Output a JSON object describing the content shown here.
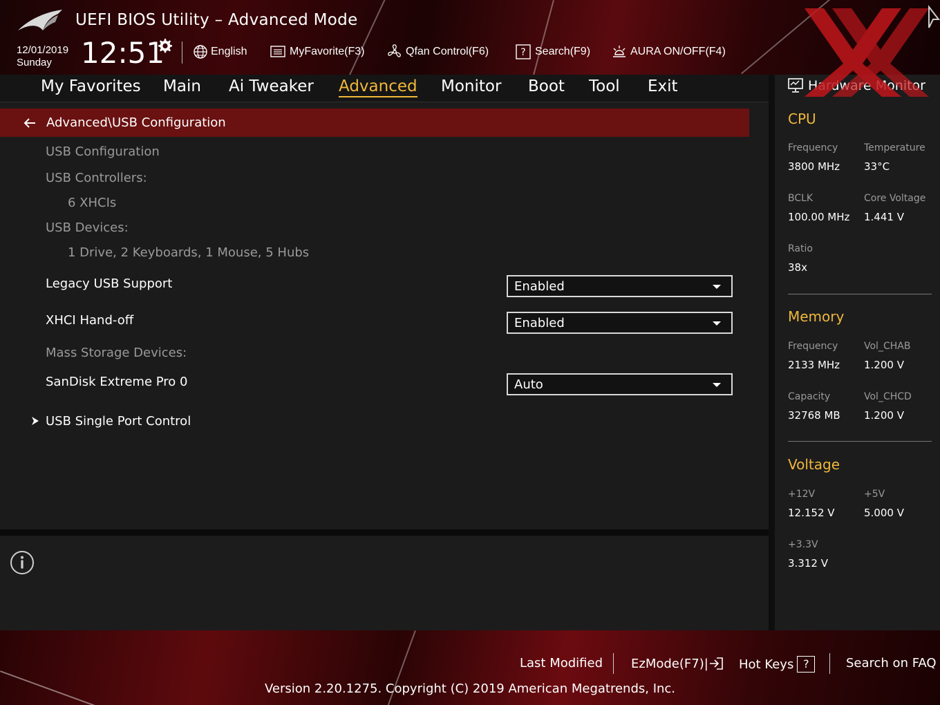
{
  "header": {
    "title": "UEFI BIOS Utility – Advanced Mode",
    "date": "12/01/2019",
    "day": "Sunday",
    "time": "12:51",
    "tools": [
      {
        "label": "English",
        "icon": "globe-icon"
      },
      {
        "label": "MyFavorite(F3)",
        "icon": "favorite-list-icon"
      },
      {
        "label": "Qfan Control(F6)",
        "icon": "fan-icon"
      },
      {
        "label": "Search(F9)",
        "icon": "search-help-icon"
      },
      {
        "label": "AURA ON/OFF(F4)",
        "icon": "aura-light-icon"
      }
    ]
  },
  "nav": {
    "tabs": [
      "My Favorites",
      "Main",
      "Ai Tweaker",
      "Advanced",
      "Monitor",
      "Boot",
      "Tool",
      "Exit"
    ],
    "active": "Advanced"
  },
  "main": {
    "breadcrumb": "Advanced\\USB Configuration",
    "items": {
      "usb_config": "USB Configuration",
      "controllers_label": "USB Controllers:",
      "controllers_value": "6 XHCIs",
      "devices_label": "USB Devices:",
      "devices_value": "1 Drive, 2 Keyboards, 1 Mouse, 5 Hubs",
      "legacy_label": "Legacy USB Support",
      "legacy_value": "Enabled",
      "xhci_label": "XHCI Hand-off",
      "xhci_value": "Enabled",
      "mass_label": "Mass Storage Devices:",
      "sandisk_label": "SanDisk Extreme Pro 0",
      "sandisk_value": "Auto",
      "single_port_label": "USB Single Port Control"
    }
  },
  "hw_monitor": {
    "title": "Hardware Monitor",
    "cpu": {
      "title": "CPU",
      "frequency_label": "Frequency",
      "frequency": "3800 MHz",
      "temperature_label": "Temperature",
      "temperature": "33°C",
      "bclk_label": "BCLK",
      "bclk": "100.00 MHz",
      "core_voltage_label": "Core Voltage",
      "core_voltage": "1.441 V",
      "ratio_label": "Ratio",
      "ratio": "38x"
    },
    "memory": {
      "title": "Memory",
      "frequency_label": "Frequency",
      "frequency": "2133 MHz",
      "vol_chab_label": "Vol_CHAB",
      "vol_chab": "1.200 V",
      "capacity_label": "Capacity",
      "capacity": "32768 MB",
      "vol_chcd_label": "Vol_CHCD",
      "vol_chcd": "1.200 V"
    },
    "voltage": {
      "title": "Voltage",
      "v12_label": "+12V",
      "v12": "12.152 V",
      "v5_label": "+5V",
      "v5": "5.000 V",
      "v33_label": "+3.3V",
      "v33": "3.312 V"
    }
  },
  "footer": {
    "last_modified": "Last Modified",
    "ezmode": "EzMode(F7)|",
    "hot_keys": "Hot Keys",
    "hot_keys_key": "?",
    "search_faq": "Search on FAQ",
    "version": "Version 2.20.1275. Copyright (C) 2019 American Megatrends, Inc."
  },
  "colors": {
    "accent": "#f0b73a",
    "breadcrumb_bg": "#6a1111",
    "panel_bg": "#1b1b1c",
    "xx_watermark": "#c0161b"
  }
}
